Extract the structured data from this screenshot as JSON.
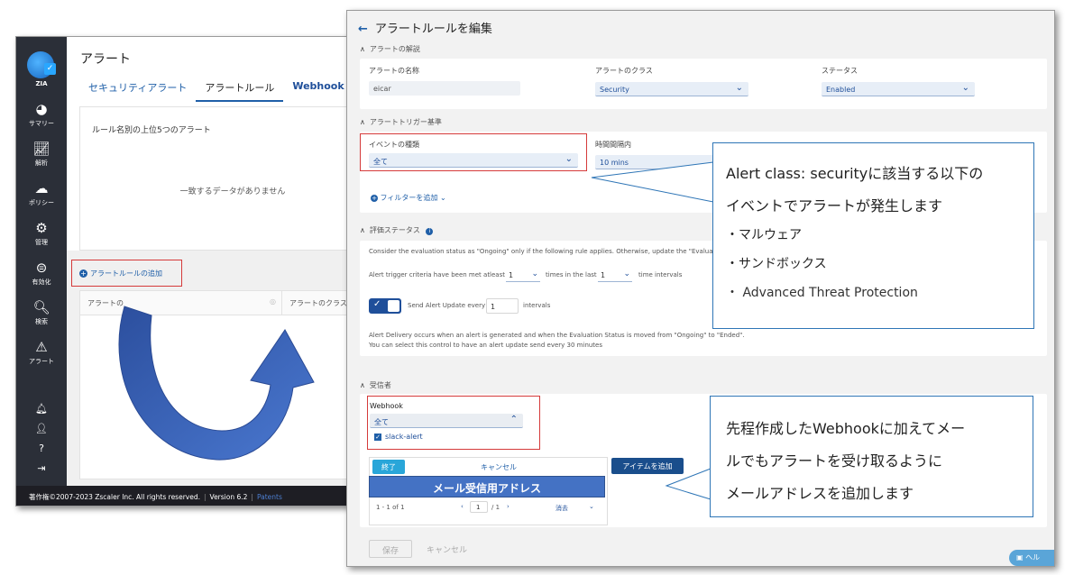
{
  "back_window": {
    "brand": "ZIA",
    "nav": [
      {
        "icon": "dashboard-icon",
        "label": "サマリー"
      },
      {
        "icon": "chart-icon",
        "label": "解析"
      },
      {
        "icon": "cloud-icon",
        "label": "ポリシー"
      },
      {
        "icon": "gears-icon",
        "label": "管理"
      },
      {
        "icon": "activate-icon",
        "label": "有効化"
      },
      {
        "icon": "search-icon",
        "label": "検索"
      },
      {
        "icon": "alert-icon",
        "label": "アラート"
      }
    ],
    "title": "アラート",
    "tabs": [
      "セキュリティアラート",
      "アラートルール",
      "Webhook"
    ],
    "card_heading": "ルール名別の上位5つのアラート",
    "card_empty": "一致するデータがありません",
    "add_rule": "アラートルールの追加",
    "table_headers": [
      "アラートの",
      "アラートのクラス"
    ],
    "footer": {
      "copyright": "著作権©2007-2023 Zscaler Inc. All rights reserved.",
      "version": "Version 6.2",
      "patents": "Patents"
    }
  },
  "front_window": {
    "title": "アラートルールを編集",
    "section_description": "アラートの解説",
    "name_label": "アラートの名称",
    "name_value": "eicar",
    "class_label": "アラートのクラス",
    "class_value": "Security",
    "status_label": "ステータス",
    "status_value": "Enabled",
    "section_trigger": "アラートトリガー基準",
    "event_label": "イベントの種類",
    "event_value": "全て",
    "time_label": "時間間隔内",
    "time_value": "10 mins",
    "add_filter": "フィルターを追加",
    "section_eval": "評価ステータス",
    "eval_note": "Consider the evaluation status as \"Ongoing\" only if the following rule applies. Otherwise, update the \"Evaluation",
    "criteria_text": "Alert trigger criteria have been met atleast",
    "criteria_count": "1",
    "times_in_last": "times in the last",
    "interval_count": "1",
    "time_intervals": "time intervals",
    "send_update_text": "Send Alert Update every",
    "send_update_value": "1",
    "intervals": "intervals",
    "delivery_note_1": "Alert Delivery occurs when an alert is generated and when the Evaluation Status is moved from \"Ongoing\" to \"Ended\".",
    "delivery_note_2": "You can select this control to have an alert update send every 30 minutes",
    "section_recipients": "受信者",
    "webhook_label": "Webhook",
    "webhook_value": "全て",
    "webhook_option": "slack-alert",
    "done": "終了",
    "cancel": "キャンセル",
    "add_item": "アイテムを追加",
    "email_bar": "メール受信用アドレス",
    "pager": "1 - 1 of 1",
    "page_current": "1",
    "page_total": "/ 1",
    "clear": "消去",
    "save": "保存",
    "cancel_footer": "キャンセル",
    "help": "ヘル"
  },
  "callouts": {
    "top_line1": "Alert class: securityに該当する以下の",
    "top_line2": "イベントでアラートが発生します",
    "top_items": [
      "・マルウェア",
      "・サンドボックス",
      "・ Advanced Threat Protection"
    ],
    "bottom_lines": [
      "先程作成したWebhookに加えてメー",
      "ルでもアラートを受け取るように",
      "メールアドレスを追加します"
    ]
  },
  "colors": {
    "accent": "#1f5fa8",
    "sidebar": "#2b2f38",
    "highlight": "#d53a3a",
    "callout_border": "#2e75b6",
    "arrow": "#3a62b8"
  }
}
